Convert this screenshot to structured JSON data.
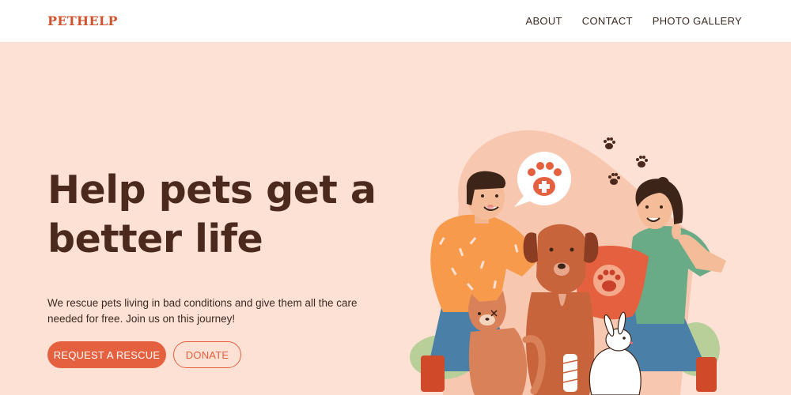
{
  "nav": {
    "brand": "PETHELP",
    "links": [
      "ABOUT",
      "CONTACT",
      "PHOTO GALLERY"
    ]
  },
  "hero": {
    "headline_line1": "Help pets get a",
    "headline_line2": "better life",
    "lead_line1": "We rescue pets living in bad conditions and give them all the care",
    "lead_line2": "needed for free. Join us on this journey!",
    "primary_button": "REQUEST A RESCUE",
    "secondary_button": "DONATE"
  },
  "colors": {
    "accent": "#e5603f",
    "brand": "#d0542f",
    "background": "#fde1d4",
    "heading": "#4b2a1d"
  },
  "illustration": {
    "icons": [
      "paw-medical-icon",
      "paw-print-icon",
      "paw-cushion-icon"
    ]
  }
}
